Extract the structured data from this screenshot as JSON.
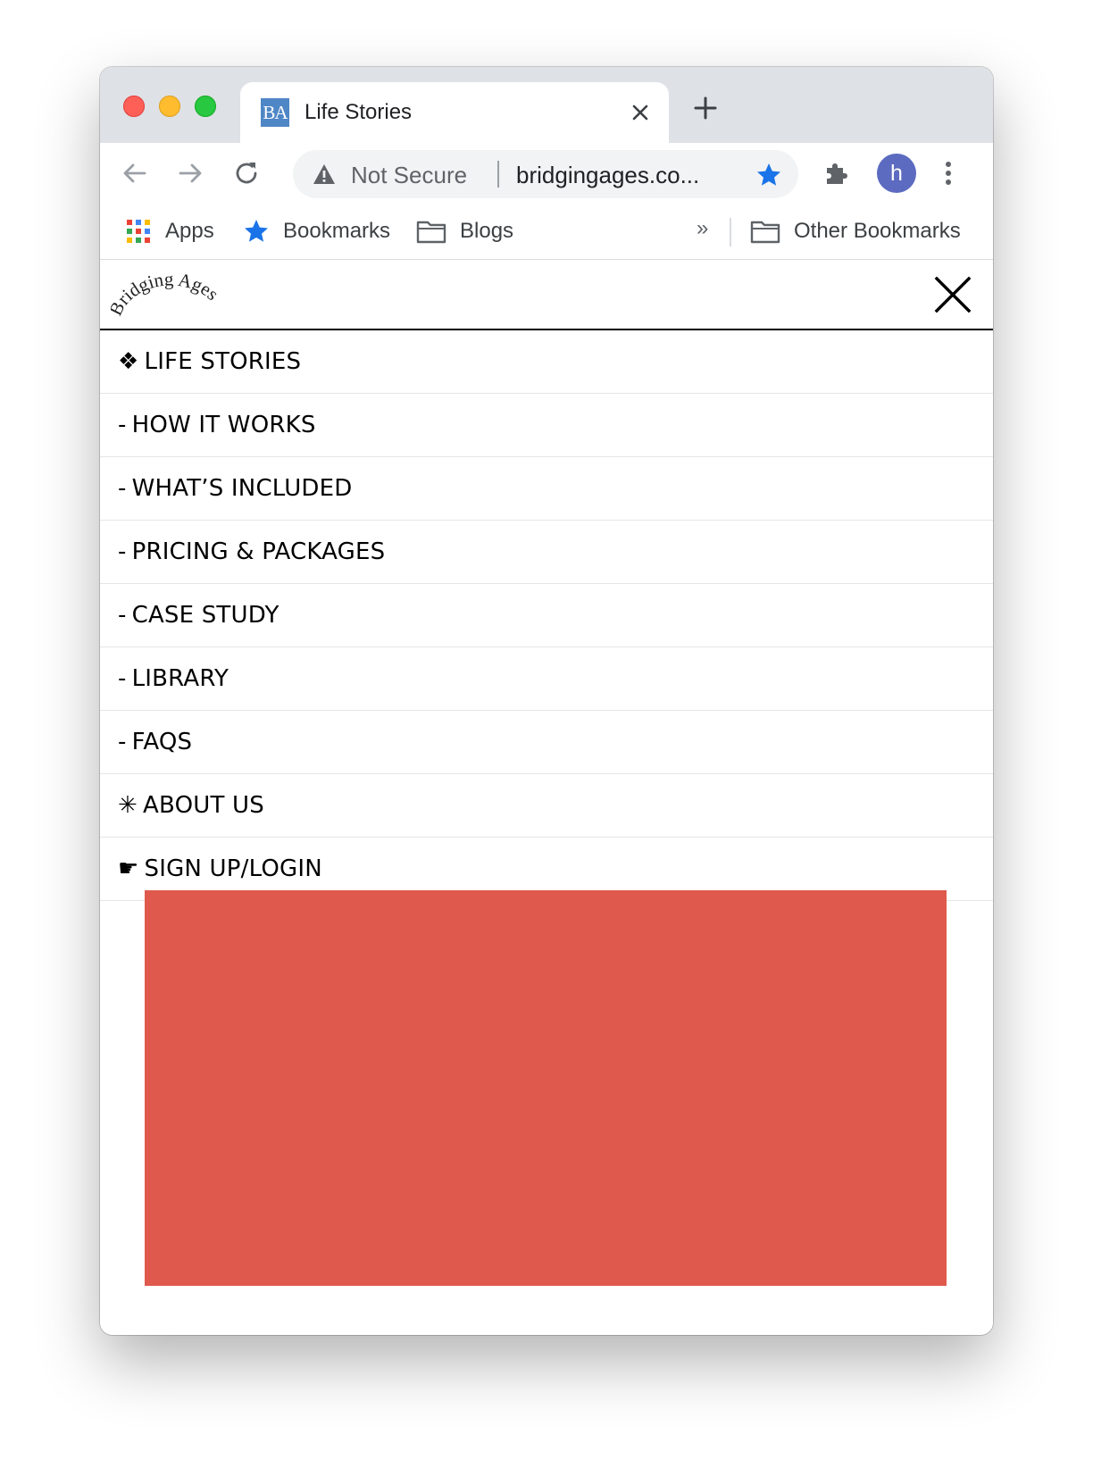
{
  "browser": {
    "tab": {
      "favicon_text": "BA",
      "title": "Life Stories"
    },
    "address_bar": {
      "security_label": "Not Secure",
      "url": "bridgingages.co..."
    },
    "profile_initial": "h",
    "bookmarks": {
      "items": [
        {
          "label": "Apps",
          "icon": "apps-grid-icon"
        },
        {
          "label": "Bookmarks",
          "icon": "star-icon"
        },
        {
          "label": "Blogs",
          "icon": "folder-icon"
        }
      ],
      "overflow_label": "»",
      "other_bookmarks_label": "Other Bookmarks"
    }
  },
  "site": {
    "logo_text": "Bridging Ages",
    "menu": [
      {
        "glyph": "❖",
        "label": "LIFE STORIES"
      },
      {
        "glyph": "-",
        "label": "HOW IT WORKS"
      },
      {
        "glyph": "-",
        "label": "WHAT’S INCLUDED"
      },
      {
        "glyph": "-",
        "label": "PRICING & PACKAGES"
      },
      {
        "glyph": "-",
        "label": "CASE STUDY"
      },
      {
        "glyph": "-",
        "label": "LIBRARY"
      },
      {
        "glyph": "-",
        "label": "FAQS"
      },
      {
        "glyph": "✳",
        "label": "ABOUT US"
      },
      {
        "glyph": "☛",
        "label": "SIGN UP/LOGIN"
      }
    ]
  },
  "colors": {
    "hero_block": "#df5a4d",
    "star_accent": "#1a73e8",
    "avatar": "#5c6bc0"
  }
}
